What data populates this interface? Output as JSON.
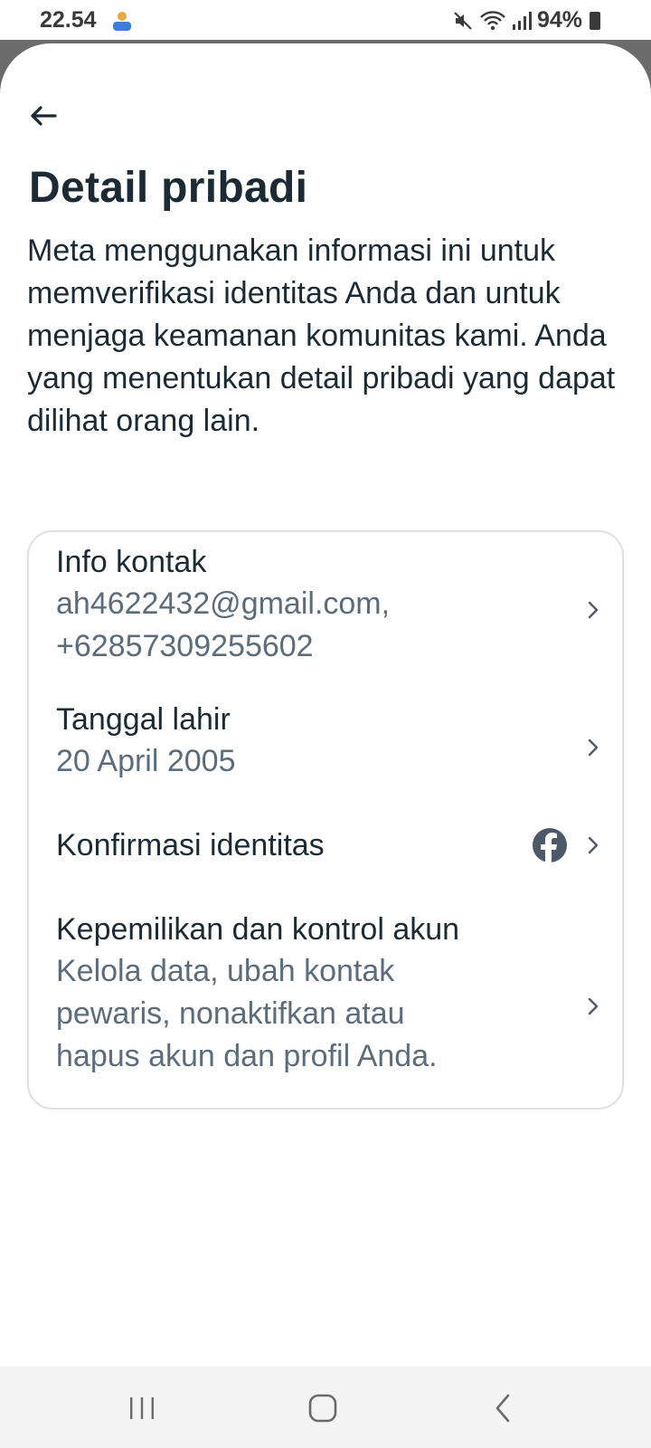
{
  "status_bar": {
    "time": "22.54",
    "battery": "94%",
    "icons": [
      "notification-icon",
      "mute-icon",
      "wifi-icon",
      "signal-icon",
      "battery-icon"
    ]
  },
  "header": {
    "back_icon": "arrow-left-icon",
    "title": "Detail pribadi",
    "description": "Meta menggunakan informasi ini untuk memverifikasi identitas Anda dan untuk menjaga keamanan komunitas kami. Anda yang menentukan detail pribadi yang dapat dilihat orang lain."
  },
  "items": [
    {
      "title": "Info kontak",
      "subtitle_line1": "ah4622432@gmail.com,",
      "subtitle_line2": "+62857309255602",
      "icon": "chevron-right-icon"
    },
    {
      "title": "Tanggal lahir",
      "subtitle_line1": "20 April 2005",
      "icon": "chevron-right-icon"
    },
    {
      "title": "Konfirmasi identitas",
      "icon": "chevron-right-icon",
      "badge_icon": "facebook-icon"
    },
    {
      "title": "Kepemilikan dan kontrol akun",
      "subtitle_line1": "Kelola data, ubah kontak",
      "subtitle_line2": "pewaris, nonaktifkan atau",
      "subtitle_line3": "hapus akun dan profil Anda.",
      "icon": "chevron-right-icon"
    }
  ],
  "nav_bar": {
    "icons": [
      "recent-apps-icon",
      "home-icon",
      "back-icon"
    ]
  },
  "colors": {
    "text_primary": "#1c2b33",
    "text_secondary": "#5d6c7b",
    "card_border": "#dde1e5",
    "facebook_icon": "#4b5968"
  }
}
